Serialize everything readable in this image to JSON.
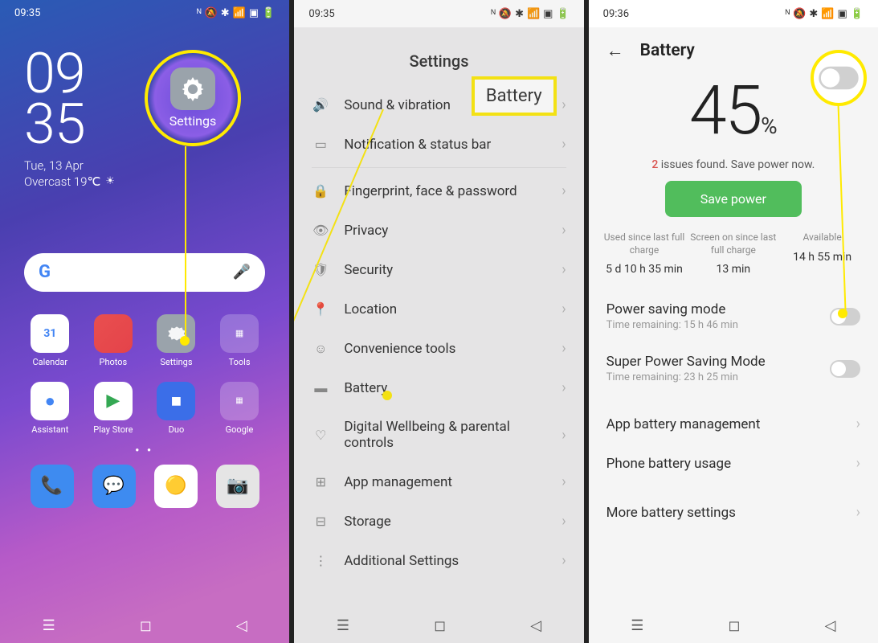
{
  "phone1": {
    "time": "09:35",
    "clock_hr": "09",
    "clock_min": "35",
    "date": "Tue, 13 Apr",
    "weather": "Overcast 19℃",
    "highlight_label": "Settings",
    "apps": [
      {
        "label": "Calendar",
        "icon": "📅",
        "bg": "#fff"
      },
      {
        "label": "Photos",
        "icon": "",
        "bg": "linear-gradient(135deg,#e94f4f,#e4434a)"
      },
      {
        "label": "Settings",
        "icon": "⚙",
        "bg": "#9aa3ab"
      },
      {
        "label": "Tools",
        "icon": "🧰",
        "bg": "rgba(255,255,255,0.25)"
      },
      {
        "label": "Assistant",
        "icon": "🔵",
        "bg": "#fff"
      },
      {
        "label": "Play Store",
        "icon": "▶",
        "bg": "#fff"
      },
      {
        "label": "Duo",
        "icon": "📹",
        "bg": "#3b6ee8"
      },
      {
        "label": "Google",
        "icon": "G",
        "bg": "rgba(255,255,255,0.25)"
      }
    ],
    "dock": [
      {
        "name": "phone",
        "icon": "📞",
        "bg": "#3e8bf0"
      },
      {
        "name": "messages",
        "icon": "💬",
        "bg": "#3e8bf0"
      },
      {
        "name": "chrome",
        "icon": "🌐",
        "bg": "#fff"
      },
      {
        "name": "camera",
        "icon": "📷",
        "bg": "#e8e8e8"
      }
    ]
  },
  "phone2": {
    "time": "09:35",
    "title": "Settings",
    "items": [
      {
        "label": "Sound & vibration",
        "icon": "🔊"
      },
      {
        "label": "Notification & status bar",
        "icon": "▭"
      },
      {
        "label": "Fingerprint, face & password",
        "icon": "🔒"
      },
      {
        "label": "Privacy",
        "icon": "👁"
      },
      {
        "label": "Security",
        "icon": "🛡"
      },
      {
        "label": "Location",
        "icon": "📍"
      },
      {
        "label": "Convenience tools",
        "icon": "☺"
      },
      {
        "label": "Battery",
        "icon": "▬"
      },
      {
        "label": "Digital Wellbeing & parental controls",
        "icon": "♡"
      },
      {
        "label": "App management",
        "icon": "⊞"
      },
      {
        "label": "Storage",
        "icon": "⊟"
      },
      {
        "label": "Additional Settings",
        "icon": "⋮"
      }
    ],
    "callout": "Battery"
  },
  "phone3": {
    "time": "09:36",
    "title": "Battery",
    "percent_num": "45",
    "percent_sym": "%",
    "issues_count": "2",
    "issues_text": " issues found. Save power now.",
    "save_btn": "Save power",
    "stats": [
      {
        "label": "Used since last full charge",
        "value": "5 d 10 h 35 min"
      },
      {
        "label": "Screen on since last full charge",
        "value": "13 min"
      },
      {
        "label": "Available",
        "value": "14 h 55 min"
      }
    ],
    "power_saving": {
      "label": "Power saving mode",
      "sub": "Time remaining:  15 h 46 min"
    },
    "super_saving": {
      "label": "Super Power Saving Mode",
      "sub": "Time remaining:  23 h 25 min"
    },
    "rows": [
      {
        "label": "App battery management"
      },
      {
        "label": "Phone battery usage"
      },
      {
        "label": "More battery settings"
      }
    ]
  }
}
